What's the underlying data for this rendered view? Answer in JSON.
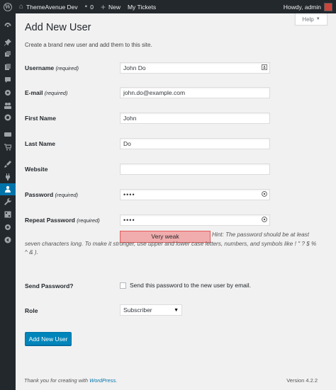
{
  "adminbar": {
    "site_name": "ThemeAvenue Dev",
    "comments_count": "0",
    "new_label": "New",
    "tickets_label": "My Tickets",
    "greeting": "Howdy, admin"
  },
  "help_tab": {
    "label": "Help"
  },
  "page": {
    "title": "Add New User",
    "intro": "Create a brand new user and add them to this site."
  },
  "form": {
    "username": {
      "label": "Username",
      "required": "(required)",
      "value": "John Do"
    },
    "email": {
      "label": "E-mail",
      "required": "(required)",
      "value": "john.do@example.com"
    },
    "first_name": {
      "label": "First Name",
      "value": "John"
    },
    "last_name": {
      "label": "Last Name",
      "value": "Do"
    },
    "website": {
      "label": "Website",
      "value": ""
    },
    "password": {
      "label": "Password",
      "required": "(required)",
      "value": "••••"
    },
    "repeat_password": {
      "label": "Repeat Password",
      "required": "(required)",
      "value": "••••"
    },
    "strength": "Very weak",
    "hint": "Hint: The password should be at least seven characters long. To make it stronger, use upper and lower case letters, numbers, and symbols like ! \" ? $ % ^ & ).",
    "send_password": {
      "label": "Send Password?",
      "text": "Send this password to the new user by email.",
      "checked": false
    },
    "role": {
      "label": "Role",
      "value": "Subscriber"
    },
    "submit_label": "Add New User"
  },
  "footer": {
    "thanks_prefix": "Thank you for creating with ",
    "thanks_link": "WordPress",
    "thanks_suffix": ".",
    "version": "Version 4.2.2"
  },
  "colors": {
    "adminbar_bg": "#23282d",
    "primary_button": "#0085ba",
    "current_menu": "#0073aa",
    "strength_weak_bg": "#f1adad"
  },
  "menu_icons": [
    "dashboard-icon",
    "pin-icon",
    "media-icon",
    "pages-icon",
    "comments-icon",
    "tickets-icon",
    "groups-icon",
    "support-icon",
    "woocommerce-icon",
    "products-icon",
    "appearance-icon",
    "plugins-icon",
    "users-icon",
    "tools-icon",
    "settings-icon",
    "options-icon",
    "collapse-icon"
  ]
}
